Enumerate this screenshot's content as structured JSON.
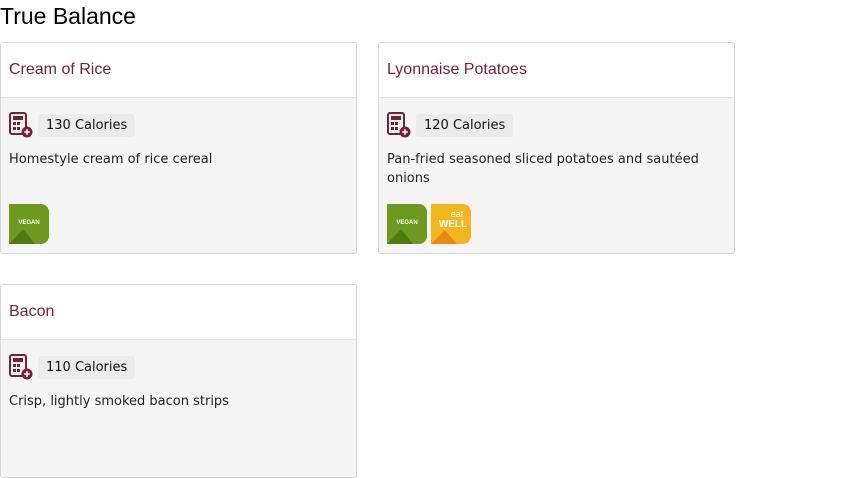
{
  "section": {
    "title": "True Balance"
  },
  "items": [
    {
      "name": "Cream of Rice",
      "calories": "130 Calories",
      "description": "Homestyle cream of rice cereal",
      "badges": [
        "vegan-icon"
      ]
    },
    {
      "name": "Lyonnaise Potatoes",
      "calories": "120 Calories",
      "description": "Pan-fried seasoned sliced potatoes and sautéed onions",
      "badges": [
        "vegan-icon",
        "eat-well-icon"
      ]
    },
    {
      "name": "Bacon",
      "calories": "110 Calories",
      "description": "Crisp, lightly smoked bacon strips",
      "badges": []
    }
  ],
  "badge_labels": {
    "vegan": "VEGAN",
    "eat_well_top": "eat",
    "eat_well_bottom": "WELL"
  },
  "colors": {
    "title": "#7a1f34",
    "vegan": "#6d9a1f",
    "eat_well": "#f5b51c"
  }
}
